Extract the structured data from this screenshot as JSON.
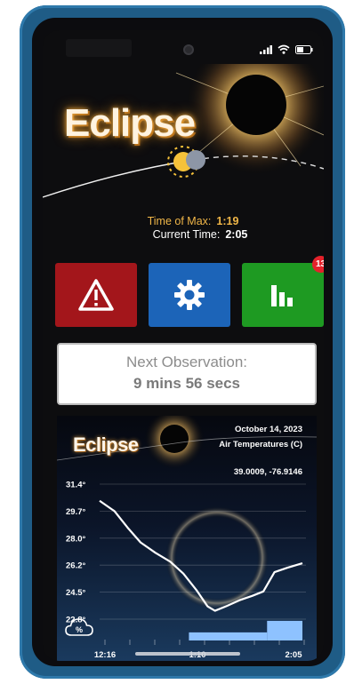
{
  "app": {
    "title": "Eclipse"
  },
  "time": {
    "max_label": "Time of Max:",
    "max_value": "1:19",
    "current_label": "Current Time:",
    "current_value": "2:05"
  },
  "buttons": {
    "warning_icon": "warning-triangle-icon",
    "settings_icon": "gear-icon",
    "stats_icon": "bar-chart-icon",
    "stats_badge": "13",
    "colors": {
      "warning": "#a3161b",
      "settings": "#1c64b8",
      "stats": "#1e9a22",
      "badge": "#e4222b"
    }
  },
  "next_observation": {
    "label": "Next Observation:",
    "value": "9 mins 56 secs"
  },
  "chart_card": {
    "title": "Eclipse",
    "date": "October 14, 2023",
    "subtitle": "Air Temperatures (C)",
    "coords": "39.0009, -76.9146",
    "cloud_icon": "cloud-percent-icon"
  },
  "chart_data": {
    "type": "line",
    "title": "Air Temperatures (C)",
    "xlabel": "",
    "ylabel": "",
    "x_tick_labels": [
      "12:16",
      "1:10",
      "2:05"
    ],
    "y_tick_labels": [
      "31.4°",
      "29.7°",
      "28.0°",
      "26.2°",
      "24.5°",
      "22.8°"
    ],
    "ylim": [
      21.9,
      32.3
    ],
    "xlim": [
      0,
      109
    ],
    "grid": true,
    "series": [
      {
        "x": [
          0,
          8,
          15,
          22,
          30,
          38,
          45,
          52,
          58,
          62,
          68,
          75,
          82,
          88,
          94,
          101,
          109
        ],
        "values": [
          31.0,
          30.3,
          29.2,
          28.2,
          27.5,
          26.9,
          26.1,
          25.0,
          23.9,
          23.6,
          23.9,
          24.3,
          24.6,
          24.9,
          26.2,
          26.5,
          26.8
        ]
      }
    ],
    "bars": {
      "x_start": [
        48,
        90
      ],
      "x_end": [
        90,
        109
      ],
      "values": [
        0.35,
        0.85
      ]
    }
  }
}
